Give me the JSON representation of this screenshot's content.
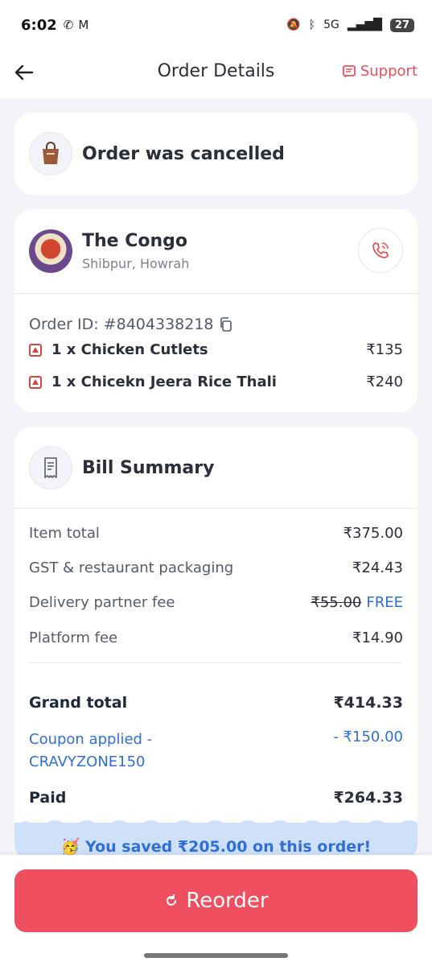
{
  "status_bar": {
    "time": "6:02",
    "network": "5G",
    "battery": "27"
  },
  "header": {
    "title": "Order Details",
    "support_label": "Support"
  },
  "status_card": {
    "message": "Order was cancelled"
  },
  "restaurant": {
    "name": "The Congo",
    "location": "Shibpur, Howrah",
    "order_id": "Order ID: #8404338218",
    "items": [
      {
        "name": "1 x Chicken Cutlets",
        "price": "₹135"
      },
      {
        "name": "1 x Chicekn Jeera Rice Thali",
        "price": "₹240"
      }
    ]
  },
  "bill": {
    "title": "Bill Summary",
    "item_total_label": "Item total",
    "item_total": "₹375.00",
    "gst_label": "GST & restaurant packaging",
    "gst": "₹24.43",
    "delivery_label": "Delivery partner fee",
    "delivery_old": "₹55.00",
    "delivery_new": "FREE",
    "platform_label": "Platform fee",
    "platform": "₹14.90",
    "grand_label": "Grand total",
    "grand": "₹414.33",
    "coupon_label_1": "Coupon applied -",
    "coupon_label_2": "CRAVYZONE150",
    "coupon": "- ₹150.00",
    "paid_label": "Paid",
    "paid": "₹264.33",
    "saved_text": "🥳 You saved ₹205.00 on this order!"
  },
  "bottom": {
    "reorder_label": "Reorder"
  },
  "colors": {
    "accent": "#ef4f5f",
    "link_blue": "#2f6fd6"
  }
}
